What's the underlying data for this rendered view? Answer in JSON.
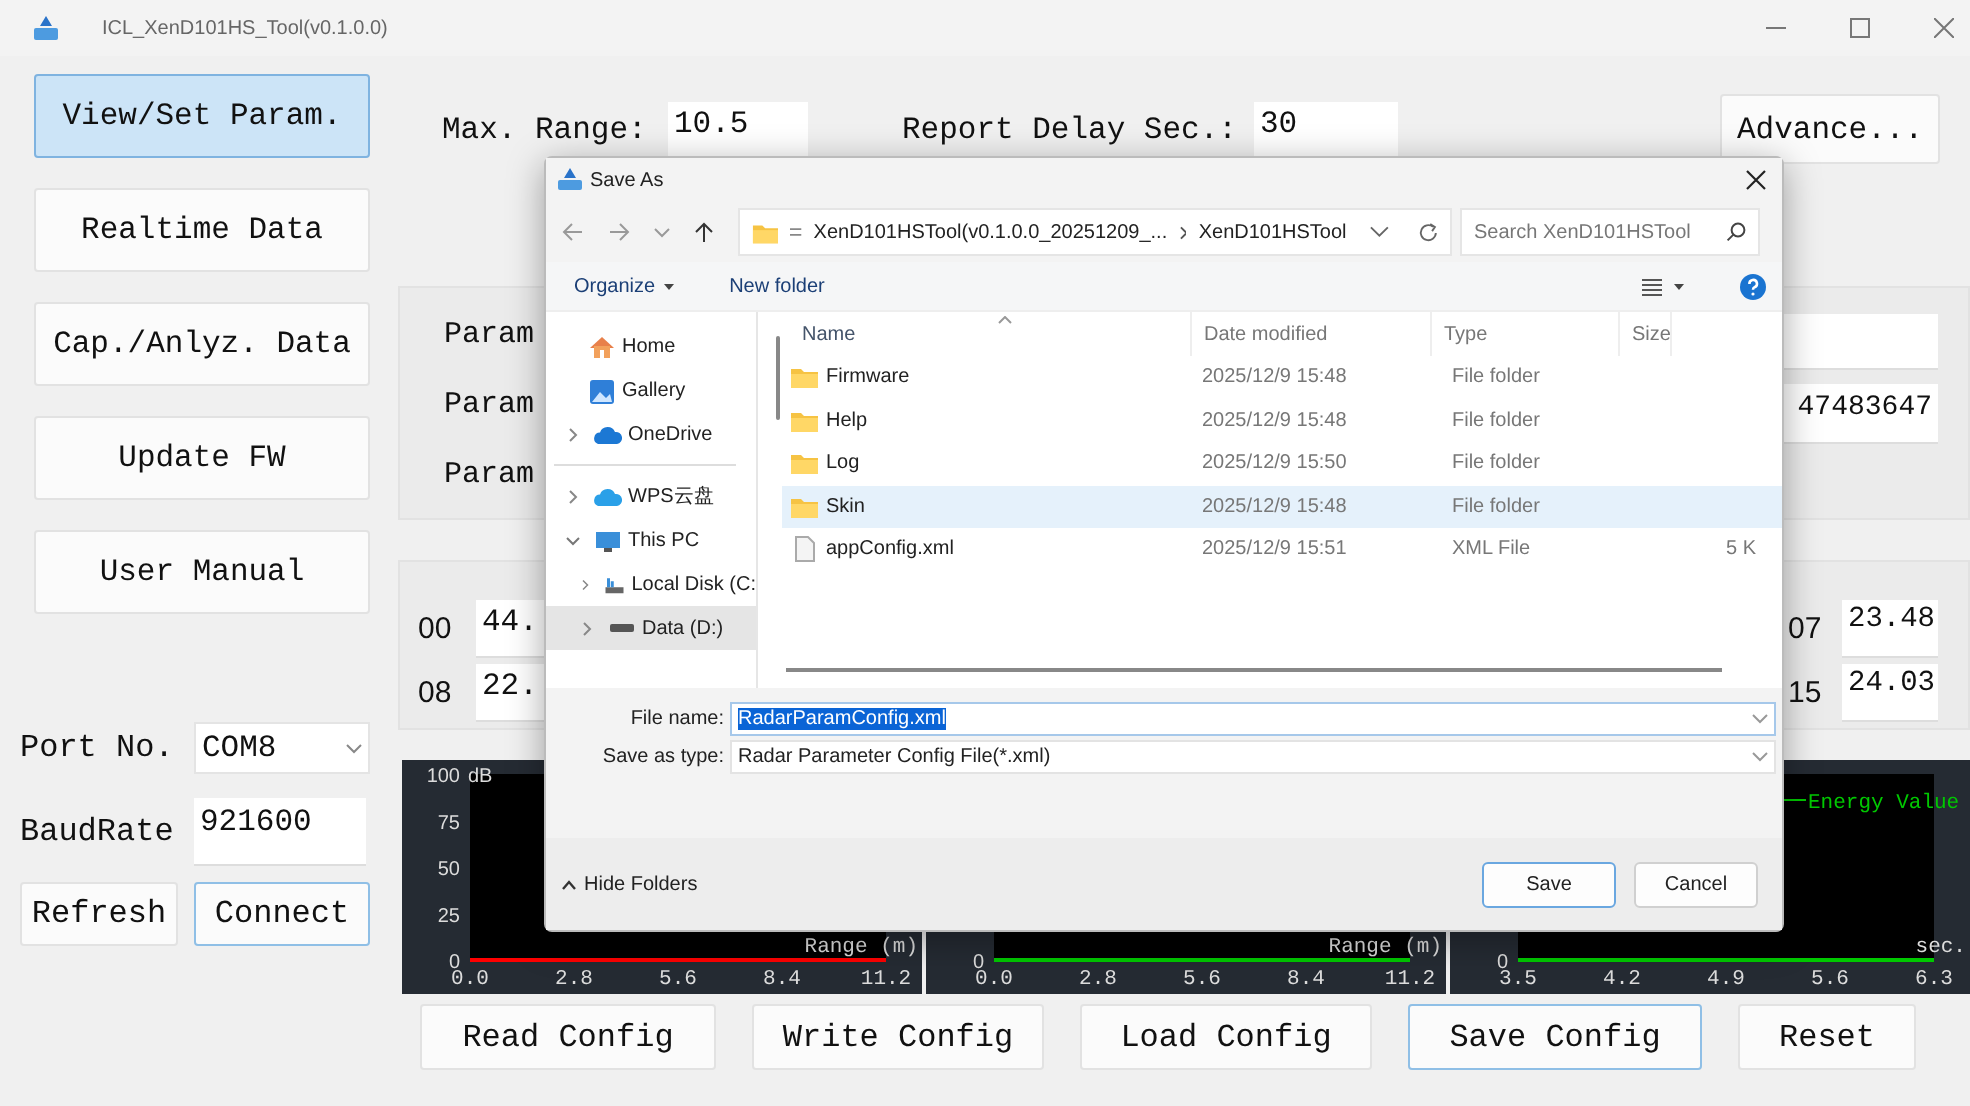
{
  "window": {
    "title": "ICL_XenD101HS_Tool(v0.1.0.0)"
  },
  "nav": [
    {
      "label": "View/Set Param.",
      "selected": true
    },
    {
      "label": "Realtime Data",
      "selected": false
    },
    {
      "label": "Cap./Anlyz. Data",
      "selected": false
    },
    {
      "label": "Update FW",
      "selected": false
    },
    {
      "label": "User Manual",
      "selected": false
    }
  ],
  "connection": {
    "port_label": "Port No.",
    "port": "COM8",
    "baud_label": "BaudRate",
    "baud": "921600",
    "buttons": [
      {
        "label": "Refresh",
        "highlighted": false
      },
      {
        "label": "Connect",
        "highlighted": true
      }
    ]
  },
  "settings": {
    "max_range_label": "Max. Range:",
    "max_range": "10.5",
    "report_delay_label": "Report Delay Sec.:",
    "report_delay": "30",
    "advance_button": "Advance..."
  },
  "params": {
    "labels": [
      "Param",
      "Param",
      "Param"
    ],
    "values": [
      "47483647"
    ]
  },
  "energy_rows": [
    {
      "left_index": "00",
      "left_value": "44.",
      "right_index": "07",
      "right_value": "23.48"
    },
    {
      "left_index": "08",
      "left_value": "22.",
      "right_index": "15",
      "right_value": "24.03"
    }
  ],
  "charts": [
    {
      "chart_data": {
        "type": "line",
        "xlabel": "Range (m)",
        "ylabel": "dB",
        "xlim": [
          0,
          11.2
        ],
        "ylim": [
          0,
          100
        ],
        "xticks": [
          {
            "value": 0,
            "label": "0.0"
          },
          {
            "value": 2.8,
            "label": "2.8"
          },
          {
            "value": 5.6,
            "label": "5.6"
          },
          {
            "value": 8.4,
            "label": "8.4"
          },
          {
            "value": 11.2,
            "label": "11.2"
          }
        ],
        "yticks": [
          0,
          25,
          50,
          75,
          100
        ],
        "x": [
          0,
          11.2
        ],
        "series": [
          {
            "color": "#ff0000",
            "values": [
              0,
              0
            ]
          }
        ]
      }
    },
    {
      "kind": "plot",
      "y_label": "0",
      "x_title": "Range (m)",
      "x_labels": [
        "0.0",
        "2.8",
        "5.6",
        "8.4",
        "11.2"
      ],
      "color": "#00c800"
    },
    {
      "kind": "plot",
      "y_label": "0",
      "x_title": "sec.",
      "x_labels": [
        "3.5",
        "4.2",
        "4.9",
        "5.6",
        "6.3"
      ],
      "color": "#00c800",
      "legend": "Energy Value"
    }
  ],
  "actions": [
    {
      "label": "Read Config",
      "highlighted": false
    },
    {
      "label": "Write Config",
      "highlighted": false
    },
    {
      "label": "Load Config",
      "highlighted": false
    },
    {
      "label": "Save Config",
      "highlighted": true
    },
    {
      "label": "Reset",
      "highlighted": false
    }
  ],
  "dialog": {
    "title": "Save As",
    "path": [
      "XenD101HSTool(v0.1.0.0_20251209_...",
      "XenD101HSTool"
    ],
    "search": {
      "placeholder": "Search XenD101HSTool"
    },
    "toolbar": [
      "Organize",
      "New folder"
    ],
    "quick_access": [
      {
        "label": "Home",
        "kind": "home",
        "selected": false
      },
      {
        "label": "Gallery",
        "kind": "gallery",
        "selected": false
      },
      {
        "label": "OneDrive",
        "kind": "onedrive",
        "expanded": false,
        "selected": false
      }
    ],
    "locations": [
      {
        "label": "WPS云盘",
        "kind": "wps",
        "expanded": false,
        "selected": false
      },
      {
        "label": "This PC",
        "kind": "pc",
        "expanded": true,
        "selected": false,
        "children": [
          {
            "label": "Local Disk (C:",
            "kind": "disk",
            "expanded": false,
            "selected": false
          },
          {
            "label": "Data (D:)",
            "kind": "drive",
            "expanded": false,
            "selected": true
          }
        ]
      }
    ],
    "columns": [
      "Name",
      "Date modified",
      "Type",
      "Size"
    ],
    "files": [
      {
        "name": "Firmware",
        "date": "2025/12/9 15:48",
        "type": "File folder",
        "kind": "folder",
        "selected": false
      },
      {
        "name": "Help",
        "date": "2025/12/9 15:48",
        "type": "File folder",
        "kind": "folder",
        "selected": false
      },
      {
        "name": "Log",
        "date": "2025/12/9 15:50",
        "type": "File folder",
        "kind": "folder",
        "selected": false
      },
      {
        "name": "Skin",
        "date": "2025/12/9 15:48",
        "type": "File folder",
        "kind": "folder",
        "selected": true
      },
      {
        "name": "appConfig.xml",
        "date": "2025/12/9 15:51",
        "type": "XML File",
        "size": "5 K",
        "kind": "file",
        "selected": false
      }
    ],
    "file_name_label": "File name:",
    "file_name": "RadarParamConfig.xml",
    "type_label": "Save as type:",
    "save_type": "Radar Parameter Config File(*.xml)",
    "hide_folders": "Hide Folders",
    "buttons": [
      {
        "label": "Save",
        "default": true
      },
      {
        "label": "Cancel",
        "default": false
      }
    ]
  }
}
